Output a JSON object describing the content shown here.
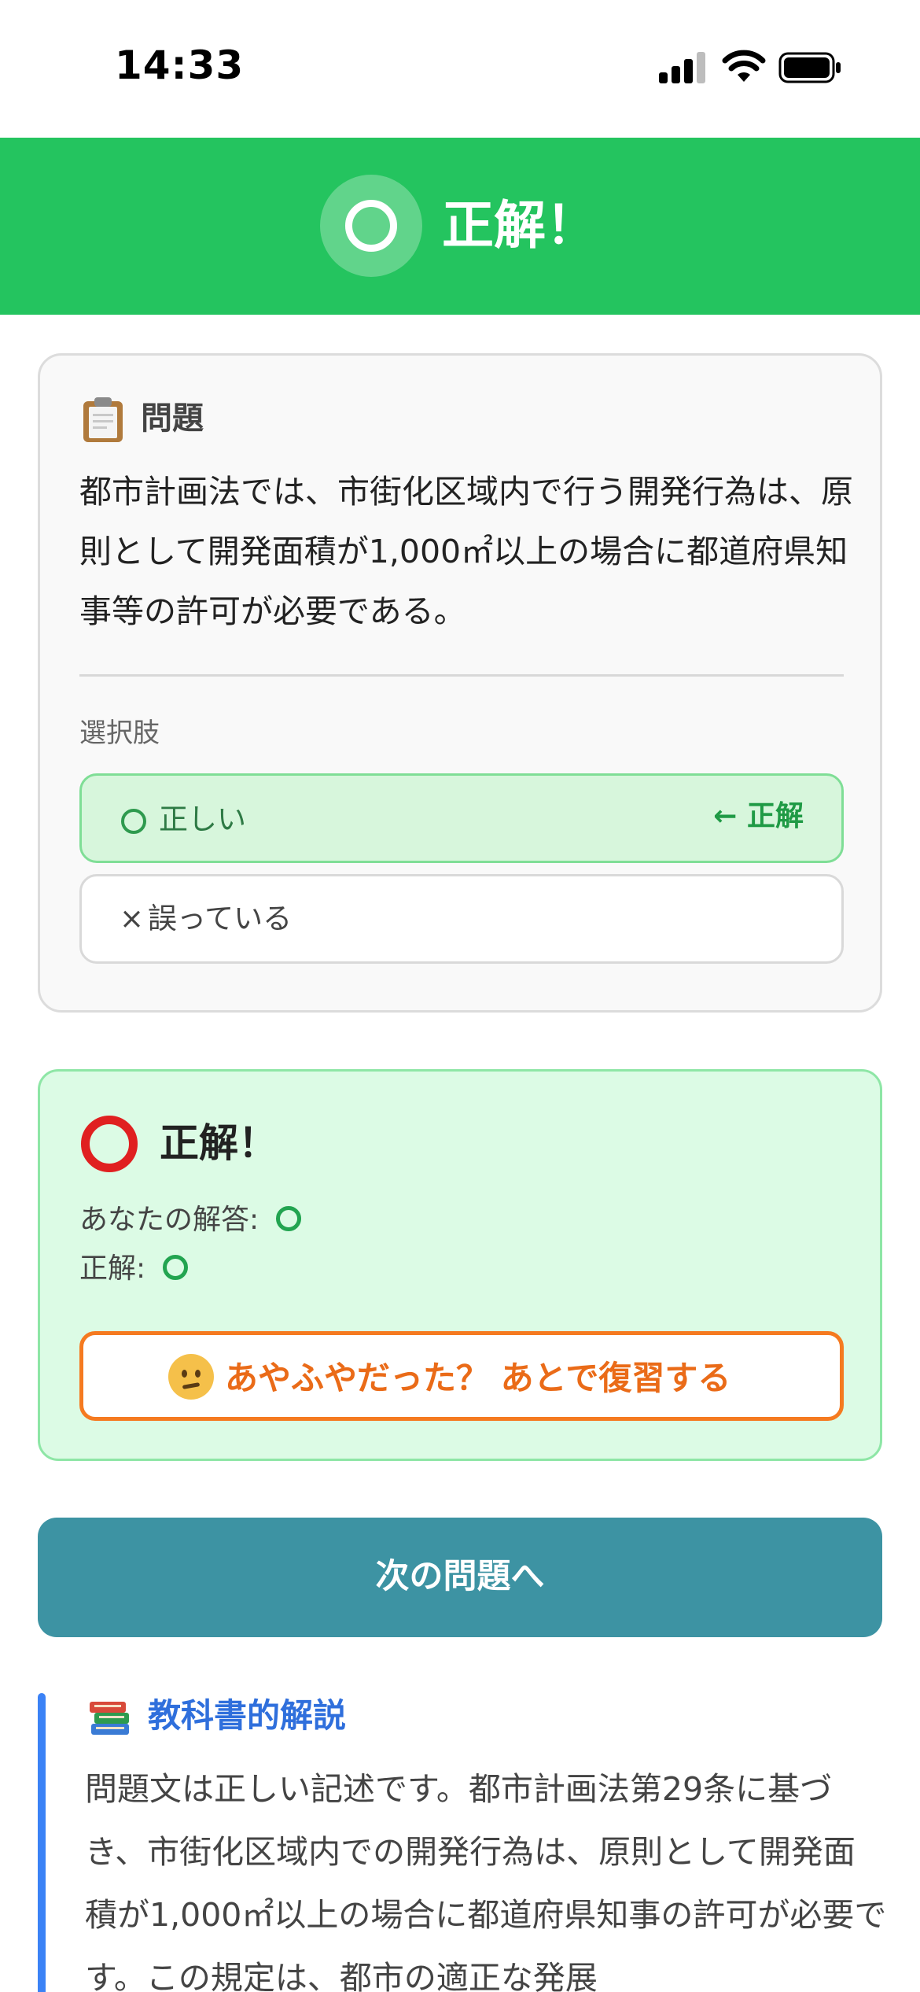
{
  "status_bar": {
    "time": "14:33"
  },
  "banner": {
    "title": "正解！"
  },
  "question_card": {
    "label": "問題",
    "text": "都市計画法では、市街化区域内で行う開発行為は、原則として開発面積が1,000㎡以上の場合に都道府県知事等の許可が必要である。",
    "choices_label": "選択肢",
    "choices": [
      {
        "label": "正しい",
        "marker": "← 正解"
      },
      {
        "symbol": "×",
        "label": "誤っている"
      }
    ]
  },
  "result_card": {
    "title": "正解！",
    "your_answer_label": "あなたの解答:",
    "correct_answer_label": "正解:",
    "review_button": "あやふやだった？ あとで復習する"
  },
  "next_button": "次の問題へ",
  "explanation": {
    "title": "教科書的解説",
    "text": "問題文は正しい記述です。都市計画法第29条に基づき、市街化区域内での開発行為は、原則として開発面積が1,000㎡以上の場合に都道府県知事の許可が必要です。この規定は、都市の適正な発展"
  },
  "colors": {
    "success_green": "#24c45f",
    "review_orange": "#f57a20",
    "next_teal": "#3d93a3",
    "explanation_blue": "#3b82f6"
  },
  "icons": [
    "clipboard-icon",
    "books-icon",
    "thinking-face-icon",
    "circle-mark-icon"
  ]
}
